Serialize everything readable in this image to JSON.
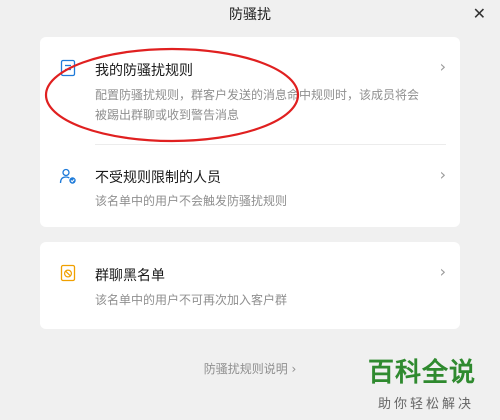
{
  "window": {
    "title": "防骚扰",
    "close_glyph": "✕"
  },
  "rules_card": {
    "items": [
      {
        "icon": "document-rules-icon",
        "title": "我的防骚扰规则",
        "description": "配置防骚扰规则，群客户发送的消息命中规则时，该成员将会被踢出群聊或收到警告消息"
      },
      {
        "icon": "user-check-icon",
        "title": "不受规则限制的人员",
        "description": "该名单中的用户不会触发防骚扰规则"
      }
    ]
  },
  "blacklist_card": {
    "icon": "ban-list-icon",
    "title": "群聊黑名单",
    "description": "该名单中的用户不可再次加入客户群"
  },
  "chevron": "›",
  "footer_link": "防骚扰规则说明 ›",
  "watermark": {
    "logo": "百科全说",
    "sub": "助你轻松解决"
  },
  "colors": {
    "accent": "#1f7bd9",
    "warning": "#f0a000",
    "annotation": "#e02020",
    "watermark": "#2f8a2f"
  }
}
